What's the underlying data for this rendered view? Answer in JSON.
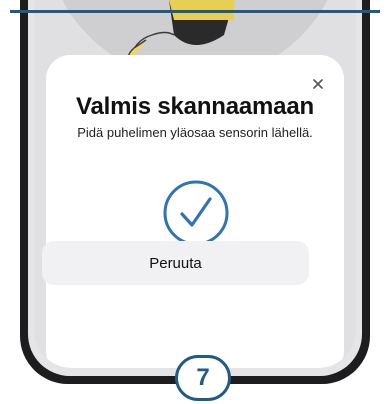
{
  "sheet": {
    "title": "Valmis skannaamaan",
    "subtitle": "Pidä puhelimen yläosaa sensorin lähellä.",
    "cancel_label": "Peruuta",
    "close_icon": "close-icon",
    "status_icon": "checkmark-circle-icon"
  },
  "step_badge": {
    "number": "7"
  },
  "colors": {
    "accent": "#1f5b86",
    "checkmark": "#2f73b8",
    "phone_frame": "#1d1d1f",
    "button_bg": "#f1f1f4"
  }
}
